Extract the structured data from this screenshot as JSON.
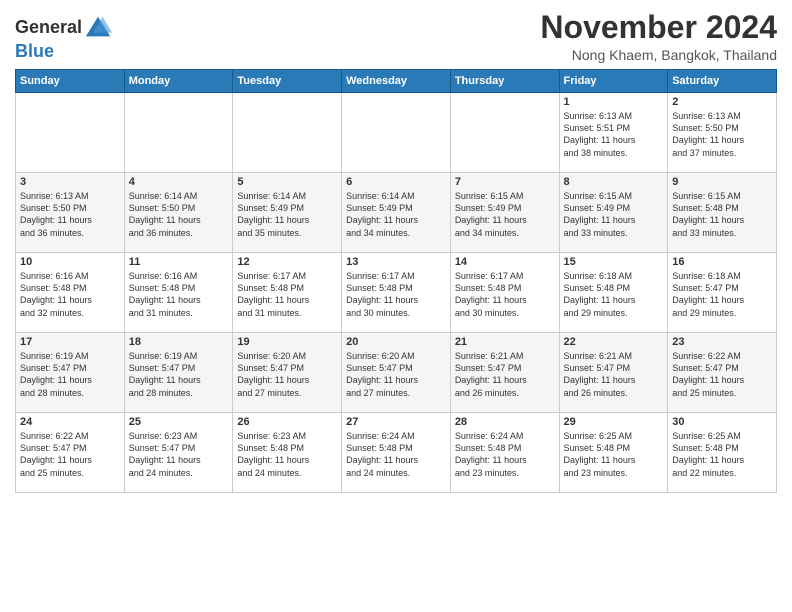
{
  "logo": {
    "general": "General",
    "blue": "Blue"
  },
  "title": "November 2024",
  "location": "Nong Khaem, Bangkok, Thailand",
  "days_of_week": [
    "Sunday",
    "Monday",
    "Tuesday",
    "Wednesday",
    "Thursday",
    "Friday",
    "Saturday"
  ],
  "weeks": [
    [
      {
        "day": "",
        "info": ""
      },
      {
        "day": "",
        "info": ""
      },
      {
        "day": "",
        "info": ""
      },
      {
        "day": "",
        "info": ""
      },
      {
        "day": "",
        "info": ""
      },
      {
        "day": "1",
        "info": "Sunrise: 6:13 AM\nSunset: 5:51 PM\nDaylight: 11 hours\nand 38 minutes."
      },
      {
        "day": "2",
        "info": "Sunrise: 6:13 AM\nSunset: 5:50 PM\nDaylight: 11 hours\nand 37 minutes."
      }
    ],
    [
      {
        "day": "3",
        "info": "Sunrise: 6:13 AM\nSunset: 5:50 PM\nDaylight: 11 hours\nand 36 minutes."
      },
      {
        "day": "4",
        "info": "Sunrise: 6:14 AM\nSunset: 5:50 PM\nDaylight: 11 hours\nand 36 minutes."
      },
      {
        "day": "5",
        "info": "Sunrise: 6:14 AM\nSunset: 5:49 PM\nDaylight: 11 hours\nand 35 minutes."
      },
      {
        "day": "6",
        "info": "Sunrise: 6:14 AM\nSunset: 5:49 PM\nDaylight: 11 hours\nand 34 minutes."
      },
      {
        "day": "7",
        "info": "Sunrise: 6:15 AM\nSunset: 5:49 PM\nDaylight: 11 hours\nand 34 minutes."
      },
      {
        "day": "8",
        "info": "Sunrise: 6:15 AM\nSunset: 5:49 PM\nDaylight: 11 hours\nand 33 minutes."
      },
      {
        "day": "9",
        "info": "Sunrise: 6:15 AM\nSunset: 5:48 PM\nDaylight: 11 hours\nand 33 minutes."
      }
    ],
    [
      {
        "day": "10",
        "info": "Sunrise: 6:16 AM\nSunset: 5:48 PM\nDaylight: 11 hours\nand 32 minutes."
      },
      {
        "day": "11",
        "info": "Sunrise: 6:16 AM\nSunset: 5:48 PM\nDaylight: 11 hours\nand 31 minutes."
      },
      {
        "day": "12",
        "info": "Sunrise: 6:17 AM\nSunset: 5:48 PM\nDaylight: 11 hours\nand 31 minutes."
      },
      {
        "day": "13",
        "info": "Sunrise: 6:17 AM\nSunset: 5:48 PM\nDaylight: 11 hours\nand 30 minutes."
      },
      {
        "day": "14",
        "info": "Sunrise: 6:17 AM\nSunset: 5:48 PM\nDaylight: 11 hours\nand 30 minutes."
      },
      {
        "day": "15",
        "info": "Sunrise: 6:18 AM\nSunset: 5:48 PM\nDaylight: 11 hours\nand 29 minutes."
      },
      {
        "day": "16",
        "info": "Sunrise: 6:18 AM\nSunset: 5:47 PM\nDaylight: 11 hours\nand 29 minutes."
      }
    ],
    [
      {
        "day": "17",
        "info": "Sunrise: 6:19 AM\nSunset: 5:47 PM\nDaylight: 11 hours\nand 28 minutes."
      },
      {
        "day": "18",
        "info": "Sunrise: 6:19 AM\nSunset: 5:47 PM\nDaylight: 11 hours\nand 28 minutes."
      },
      {
        "day": "19",
        "info": "Sunrise: 6:20 AM\nSunset: 5:47 PM\nDaylight: 11 hours\nand 27 minutes."
      },
      {
        "day": "20",
        "info": "Sunrise: 6:20 AM\nSunset: 5:47 PM\nDaylight: 11 hours\nand 27 minutes."
      },
      {
        "day": "21",
        "info": "Sunrise: 6:21 AM\nSunset: 5:47 PM\nDaylight: 11 hours\nand 26 minutes."
      },
      {
        "day": "22",
        "info": "Sunrise: 6:21 AM\nSunset: 5:47 PM\nDaylight: 11 hours\nand 26 minutes."
      },
      {
        "day": "23",
        "info": "Sunrise: 6:22 AM\nSunset: 5:47 PM\nDaylight: 11 hours\nand 25 minutes."
      }
    ],
    [
      {
        "day": "24",
        "info": "Sunrise: 6:22 AM\nSunset: 5:47 PM\nDaylight: 11 hours\nand 25 minutes."
      },
      {
        "day": "25",
        "info": "Sunrise: 6:23 AM\nSunset: 5:47 PM\nDaylight: 11 hours\nand 24 minutes."
      },
      {
        "day": "26",
        "info": "Sunrise: 6:23 AM\nSunset: 5:48 PM\nDaylight: 11 hours\nand 24 minutes."
      },
      {
        "day": "27",
        "info": "Sunrise: 6:24 AM\nSunset: 5:48 PM\nDaylight: 11 hours\nand 24 minutes."
      },
      {
        "day": "28",
        "info": "Sunrise: 6:24 AM\nSunset: 5:48 PM\nDaylight: 11 hours\nand 23 minutes."
      },
      {
        "day": "29",
        "info": "Sunrise: 6:25 AM\nSunset: 5:48 PM\nDaylight: 11 hours\nand 23 minutes."
      },
      {
        "day": "30",
        "info": "Sunrise: 6:25 AM\nSunset: 5:48 PM\nDaylight: 11 hours\nand 22 minutes."
      }
    ]
  ]
}
